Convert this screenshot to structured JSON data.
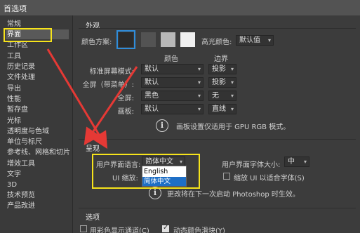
{
  "window": {
    "title": "首选项"
  },
  "sidebar": {
    "items": [
      {
        "label": "常规"
      },
      {
        "label": "界面"
      },
      {
        "label": "工作区"
      },
      {
        "label": "工具"
      },
      {
        "label": "历史记录"
      },
      {
        "label": "文件处理"
      },
      {
        "label": "导出"
      },
      {
        "label": "性能"
      },
      {
        "label": "暂存盘"
      },
      {
        "label": "光标"
      },
      {
        "label": "透明度与色域"
      },
      {
        "label": "单位与标尺"
      },
      {
        "label": "参考线、网格和切片"
      },
      {
        "label": "增效工具"
      },
      {
        "label": "文字"
      },
      {
        "label": "3D"
      },
      {
        "label": "技术预览"
      },
      {
        "label": "产品改进"
      }
    ],
    "selected": "界面"
  },
  "appearance": {
    "title": "外观",
    "color_scheme_label": "颜色方案:",
    "highlight_label": "高光颜色:",
    "highlight_value": "默认值",
    "col_color": "颜色",
    "col_border": "边界",
    "rows": [
      {
        "label": "标准屏幕模式:",
        "color": "默认",
        "border": "投影"
      },
      {
        "label": "全屏（带菜单）:",
        "color": "默认",
        "border": "投影"
      },
      {
        "label": "全屏:",
        "color": "黑色",
        "border": "无"
      },
      {
        "label": "画板:",
        "color": "默认",
        "border": "直线"
      }
    ],
    "note": "画板设置仅适用于 GPU RGB 模式。"
  },
  "presentation": {
    "title": "呈现",
    "ui_language_label": "用户界面语言:",
    "ui_language_value": "简体中文",
    "ui_font_size_label": "用户界面字体大小:",
    "ui_font_size_value": "中",
    "ui_scale_label": "UI 缩放:",
    "scale_checkbox_label": "缩放 UI 以适合字体(S)",
    "restart_note": "更改将在下一次启动 Photoshop 时生效。",
    "language_options": [
      "English",
      "简体中文"
    ]
  },
  "options": {
    "title": "选项",
    "show_channels_color_label": "用彩色显示通道(C)",
    "dynamic_sliders_label": "动态颜色滑块(Y)"
  },
  "colors": {
    "annotation_yellow": "#f6e31b",
    "annotation_red": "#e53935",
    "dropdown_highlight": "#1e6fc6"
  }
}
